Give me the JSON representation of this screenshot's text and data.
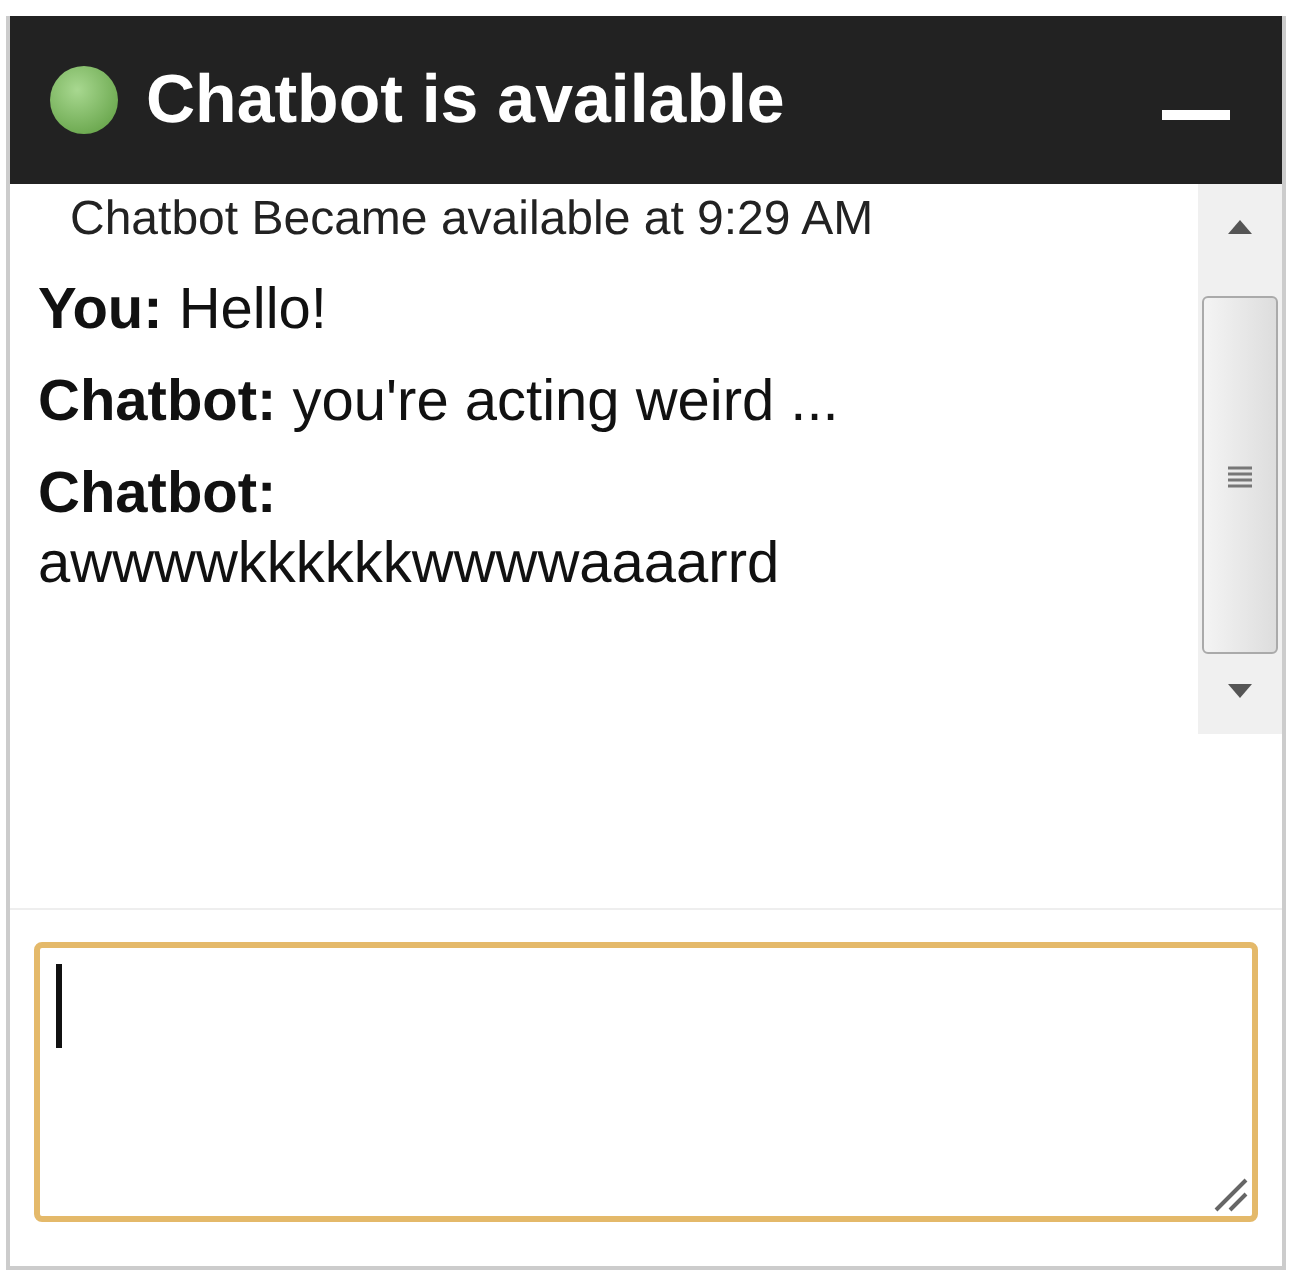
{
  "header": {
    "title": "Chatbot is available"
  },
  "chat": {
    "notice": "Chatbot Became available at 9:29 AM",
    "messages": [
      {
        "sender": "You:",
        "text": "Hello!",
        "wrapped": false
      },
      {
        "sender": "Chatbot:",
        "text": "you're acting weird ...",
        "wrapped": false
      },
      {
        "sender": "Chatbot:",
        "text": "awwwwkkkkkkwwwwaaaarrd",
        "wrapped": true
      }
    ]
  },
  "input": {
    "focused": true
  }
}
